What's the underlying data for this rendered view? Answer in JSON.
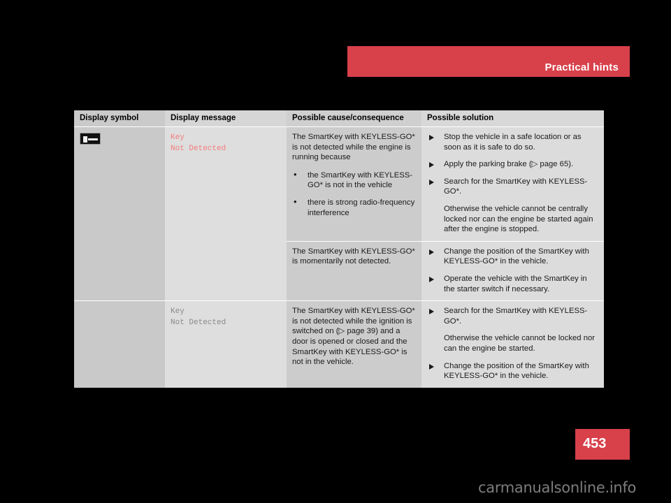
{
  "header": {
    "title": "Practical hints",
    "accent_color": "#d8404a"
  },
  "table": {
    "columns": [
      "Display symbol",
      "Display message",
      "Possible cause/consequence",
      "Possible solution"
    ],
    "rows": [
      {
        "symbol_icon": "key-symbol-icon",
        "message": "Key\nNot Detected",
        "message_color": "#f47c7c",
        "cause_intro": "The SmartKey with KEYLESS-GO* is not detected while the engine is running because",
        "cause_bullets": [
          "the SmartKey with KEYLESS-GO* is not in the vehicle",
          "there is strong radio-frequency interference"
        ],
        "solutions": [
          {
            "kind": "step",
            "text": "Stop the vehicle in a safe location or as soon as it is safe to do so."
          },
          {
            "kind": "step",
            "text": "Apply the parking brake (▷ page 65)."
          },
          {
            "kind": "step",
            "text": "Search for the SmartKey with KEYLESS-GO*."
          },
          {
            "kind": "note",
            "text": "Otherwise the vehicle cannot be centrally locked nor can the engine be started again after the engine is stopped."
          }
        ]
      },
      {
        "symbol_icon": "",
        "message": "",
        "message_color": "",
        "cause_intro": "The SmartKey with KEYLESS-GO* is momentarily not detected.",
        "cause_bullets": [],
        "solutions": [
          {
            "kind": "step",
            "text": "Change the position of the SmartKey with KEYLESS-GO* in the vehicle."
          },
          {
            "kind": "step",
            "text": "Operate the vehicle with the SmartKey in the starter switch if necessary."
          }
        ]
      },
      {
        "symbol_icon": "",
        "message": "Key\nNot Detected",
        "message_color": "#8a8a8a",
        "cause_intro": "The SmartKey with KEYLESS-GO* is not detected while the ignition is switched on (▷ page 39) and a door is opened or closed and the SmartKey with KEYLESS-GO* is not in the vehicle.",
        "cause_bullets": [],
        "solutions": [
          {
            "kind": "step",
            "text": "Search for the SmartKey with KEYLESS-GO*."
          },
          {
            "kind": "note",
            "text": "Otherwise the vehicle cannot be locked nor can the engine be started."
          },
          {
            "kind": "step",
            "text": "Change the position of the SmartKey with KEYLESS-GO* in the vehicle."
          }
        ]
      }
    ]
  },
  "footer": {
    "page_number": "453",
    "watermark": "carmanualsonline.info"
  }
}
